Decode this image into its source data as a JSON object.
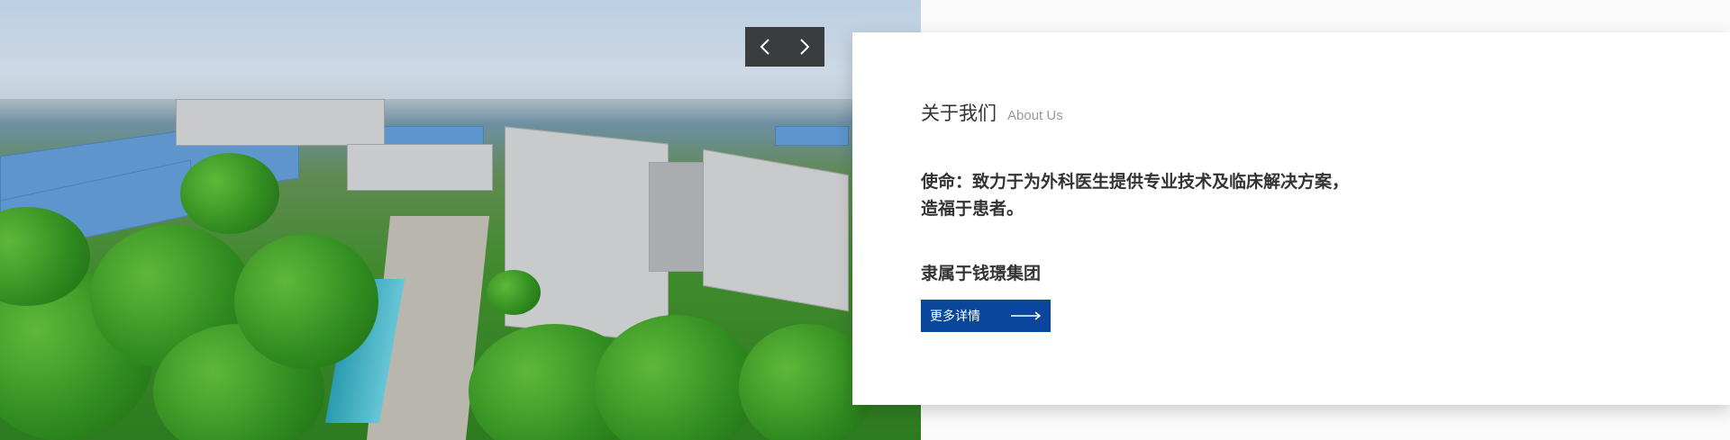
{
  "hero": {
    "image_label": "aerial-campus-photo"
  },
  "slider": {
    "prev_icon": "chevron-left-icon",
    "next_icon": "chevron-right-icon"
  },
  "about": {
    "title": "关于我们",
    "subtitle": "About Us",
    "mission_line1": "使命：致力于为外科医生提供专业技术及临床解决方案，",
    "mission_line2": "造福于患者。",
    "affiliation": "隶属于钱璟集团",
    "more_button_label": "更多详情",
    "more_button_icon": "long-arrow-right-icon"
  },
  "colors": {
    "button_bg": "#0a479c",
    "nav_bg": "#3a3c3e"
  }
}
